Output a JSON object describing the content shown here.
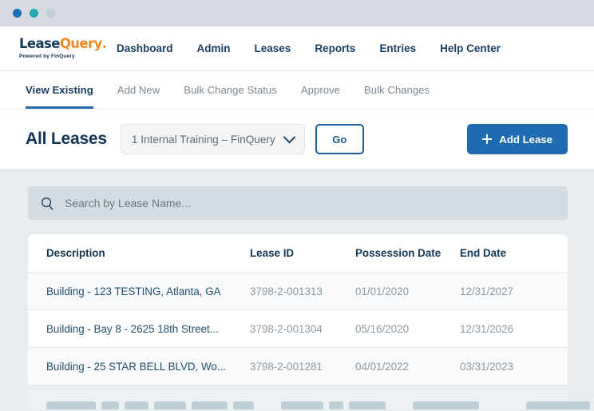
{
  "window": {
    "dots": [
      "window-dot-blue",
      "window-dot-teal",
      "window-dot-gray"
    ]
  },
  "brand": {
    "name_part1": "Lease",
    "name_part2": "Query",
    "trademark": ".",
    "tagline": "Powered by FinQuery"
  },
  "topnav": {
    "items": [
      {
        "label": "Dashboard",
        "name": "nav-dashboard"
      },
      {
        "label": "Admin",
        "name": "nav-admin"
      },
      {
        "label": "Leases",
        "name": "nav-leases"
      },
      {
        "label": "Reports",
        "name": "nav-reports"
      },
      {
        "label": "Entries",
        "name": "nav-entries"
      },
      {
        "label": "Help Center",
        "name": "nav-help-center"
      }
    ]
  },
  "subtabs": {
    "items": [
      {
        "label": "View Existing",
        "active": true
      },
      {
        "label": "Add New",
        "active": false
      },
      {
        "label": "Bulk Change Status",
        "active": false
      },
      {
        "label": "Approve",
        "active": false
      },
      {
        "label": "Bulk Changes",
        "active": false
      }
    ]
  },
  "header": {
    "title": "All Leases",
    "entity_selected": "1 Internal Training – FinQuery",
    "go_label": "Go",
    "add_lease_label": "Add Lease"
  },
  "search": {
    "value": "",
    "placeholder": "Search by Lease Name..."
  },
  "table": {
    "columns": [
      "Description",
      "Lease ID",
      "Possession Date",
      "End Date"
    ],
    "rows": [
      {
        "description": "Building - 123 TESTING, Atlanta, GA",
        "lease_id": "3798-2-001313",
        "possession_date": "01/01/2020",
        "end_date": "12/31/2027"
      },
      {
        "description": "Building - Bay 8 - 2625 18th Street...",
        "lease_id": "3798-2-001304",
        "possession_date": "05/16/2020",
        "end_date": "12/31/2026"
      },
      {
        "description": "Building - 25 STAR BELL BLVD, Wo...",
        "lease_id": "3798-2-001281",
        "possession_date": "04/01/2022",
        "end_date": "03/31/2023"
      }
    ]
  },
  "colors": {
    "accent_blue": "#1f6cb0",
    "brand_navy": "#14395c",
    "brand_orange": "#ef8b22",
    "page_bg": "#eaedf0",
    "titlebar_bg": "#d4dae0",
    "search_bg": "#d4dce2"
  }
}
